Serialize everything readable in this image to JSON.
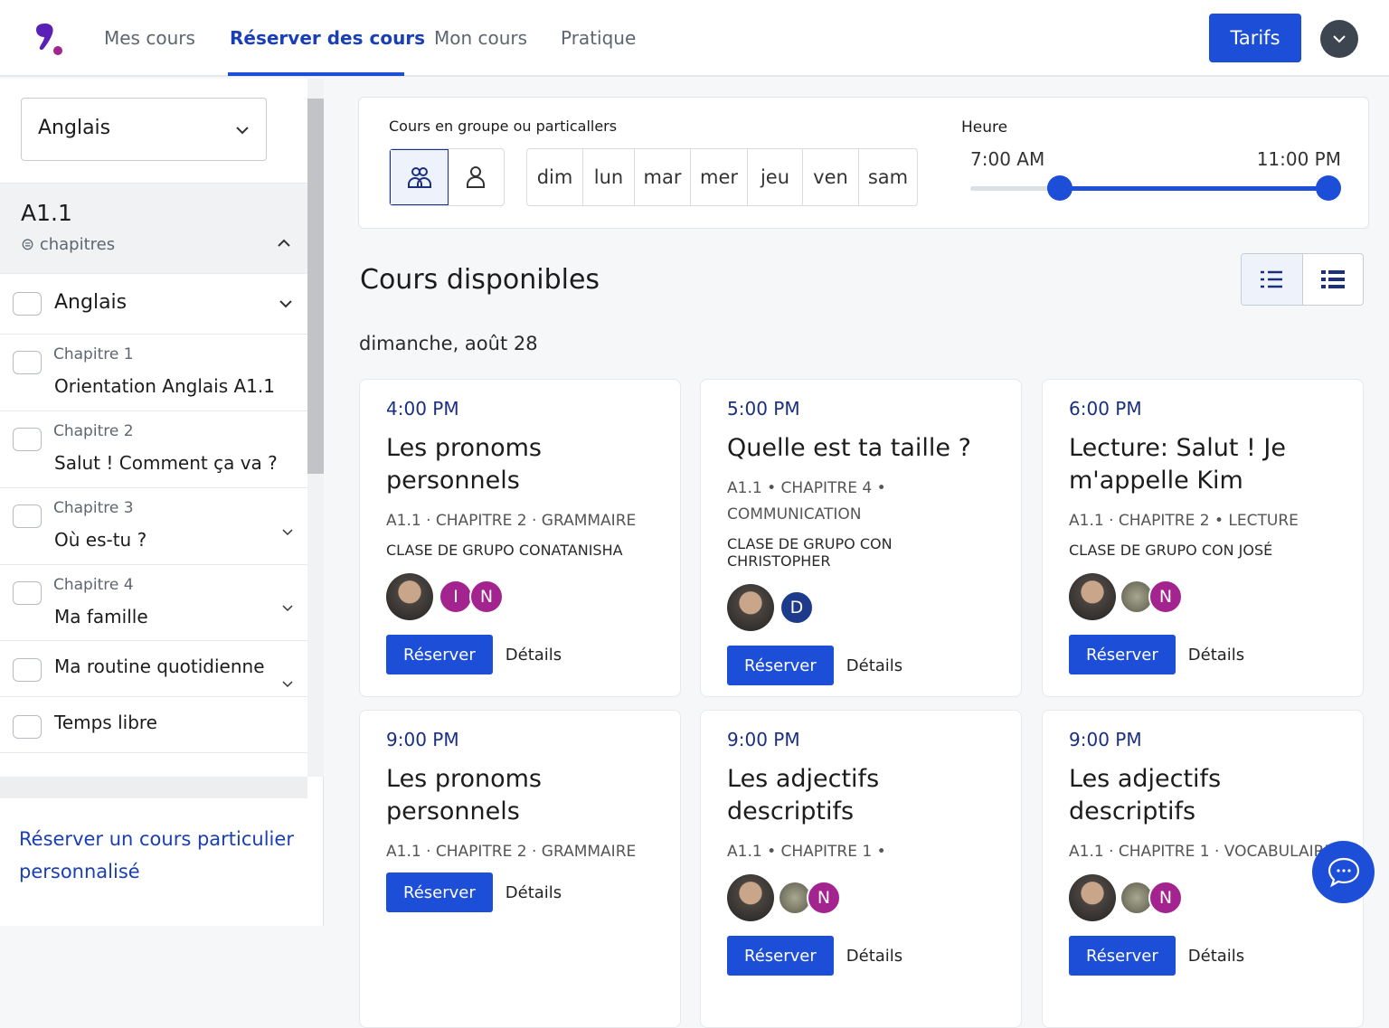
{
  "nav": {
    "items": [
      "Mes cours",
      "Réserver des cours",
      "Mon cours",
      "Pratique"
    ],
    "tarifs": "Tarifs"
  },
  "sidebar": {
    "language": "Anglais",
    "level": "A1.1",
    "chapters_label": "chapitres",
    "items": [
      {
        "sub": "",
        "title": "Anglais"
      },
      {
        "sub": "Chapitre 1",
        "title": "Orientation Anglais A1.1"
      },
      {
        "sub": "Chapitre 2",
        "title": "Salut ! Comment ça va ?"
      },
      {
        "sub": "Chapitre 3",
        "title": "Où es-tu ?"
      },
      {
        "sub": "Chapitre 4",
        "title": "Ma famille"
      },
      {
        "sub": "",
        "title": "Ma routine quotidienne"
      },
      {
        "sub": "",
        "title": "Temps libre"
      }
    ],
    "private_link": "Réserver un cours particulier personnalisé"
  },
  "filter": {
    "type_label": "Cours en groupe ou particallers",
    "days": [
      "dim",
      "lun",
      "mar",
      "mer",
      "jeu",
      "ven",
      "sam"
    ],
    "hour_label": "Heure",
    "hour_min": "7:00 AM",
    "hour_max": "11:00 PM",
    "range_fraction": [
      0.25,
      1.0
    ]
  },
  "main": {
    "title": "Cours disponibles",
    "date": "dimanche, août 28",
    "cards": [
      {
        "time": "4:00 PM",
        "title": "Les pronoms personnels",
        "meta": "A1.1 · CHAPITRE 2 · GRAMMAIRE",
        "teacher": "CLASE DE GRUPO CONATANISHA",
        "initials": [
          "I",
          "N"
        ],
        "reserve": "Réserver",
        "details": "Détails"
      },
      {
        "time": "5:00 PM",
        "title": "Quelle est ta taille ?",
        "meta": "A1.1 • CHAPITRE 4 • COMMUNICATION",
        "teacher": "CLASE DE GRUPO CON CHRISTOPHER",
        "initials": [
          "D"
        ],
        "reserve": "Réserver",
        "details": "Détails"
      },
      {
        "time": "6:00 PM",
        "title": "Lecture: Salut ! Je m'appelle Kim",
        "meta": "A1.1 · CHAPITRE 2 • LECTURE",
        "teacher": "CLASE DE GRUPO CON JOSÉ",
        "initials": [
          "N"
        ],
        "reserve": "Réserver",
        "details": "Détails"
      },
      {
        "time": "9:00 PM",
        "title": "Les pronoms personnels",
        "meta": "A1.1 · CHAPITRE 2 · GRAMMAIRE",
        "teacher": "",
        "initials": [],
        "reserve": "Réserver",
        "details": "Détails"
      },
      {
        "time": "9:00 PM",
        "title": "Les adjectifs descriptifs",
        "meta": "A1.1 • CHAPITRE 1 •",
        "teacher": "",
        "initials": [
          "N"
        ],
        "reserve": "Réserver",
        "details": "Détails"
      },
      {
        "time": "9:00 PM",
        "title": "Les adjectifs descriptifs",
        "meta": "A1.1 · CHAPITRE 1 · VOCABULAIRE",
        "teacher": "",
        "initials": [
          "N"
        ],
        "reserve": "Réserver",
        "details": "Détails"
      }
    ]
  },
  "colors": {
    "accent": "#1d4ed8",
    "initial_purple": "#a3248f",
    "initial_blue": "#1e3a8a"
  }
}
